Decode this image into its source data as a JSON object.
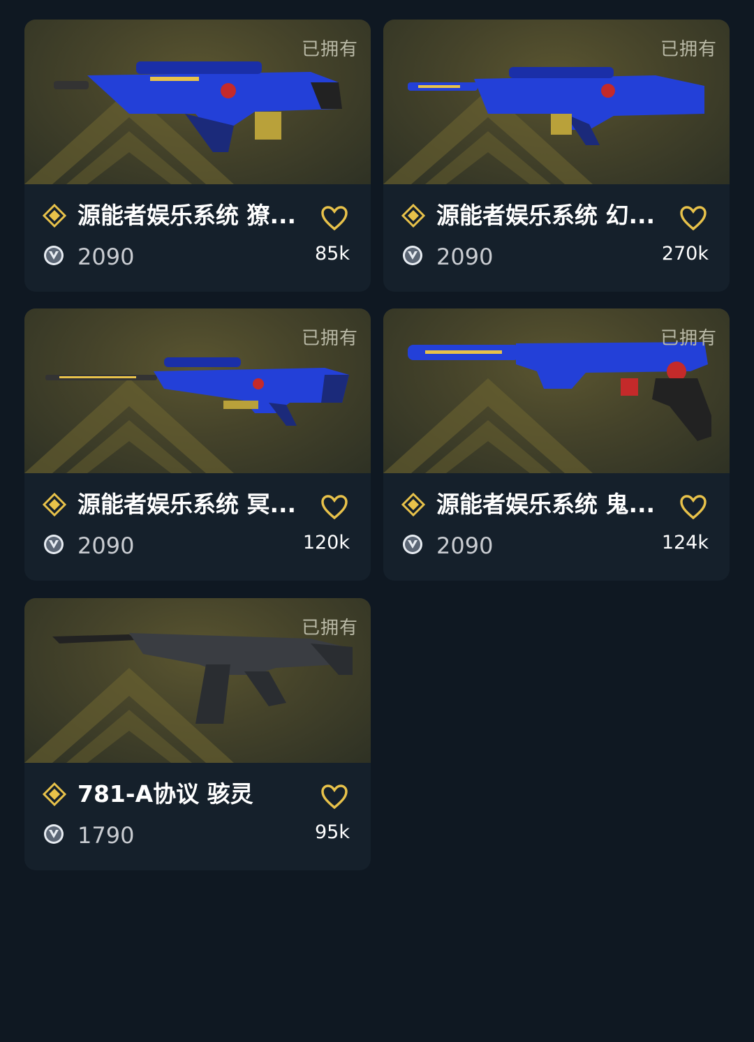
{
  "colors": {
    "background": "#0f1822",
    "card": "#15202b",
    "accent_gold": "#e8c24a",
    "weapon_blue": "#1e3fd0"
  },
  "icons": {
    "tier": "diamond-tier-icon",
    "currency": "valorant-points-icon",
    "favorite": "heart-outline-icon"
  },
  "cards": [
    {
      "owned_label": "已拥有",
      "name": "源能者娱乐系统 獠...",
      "price": "2090",
      "favorites": "85k",
      "weapon": "rifle-blue"
    },
    {
      "owned_label": "已拥有",
      "name": "源能者娱乐系统 幻...",
      "price": "2090",
      "favorites": "270k",
      "weapon": "rifle-blue"
    },
    {
      "owned_label": "已拥有",
      "name": "源能者娱乐系统 冥...",
      "price": "2090",
      "favorites": "120k",
      "weapon": "sniper-blue"
    },
    {
      "owned_label": "已拥有",
      "name": "源能者娱乐系统 鬼...",
      "price": "2090",
      "favorites": "124k",
      "weapon": "pistol-blue"
    },
    {
      "owned_label": "已拥有",
      "name": "781-A协议 骇灵",
      "price": "1790",
      "favorites": "95k",
      "weapon": "smg-black"
    }
  ]
}
